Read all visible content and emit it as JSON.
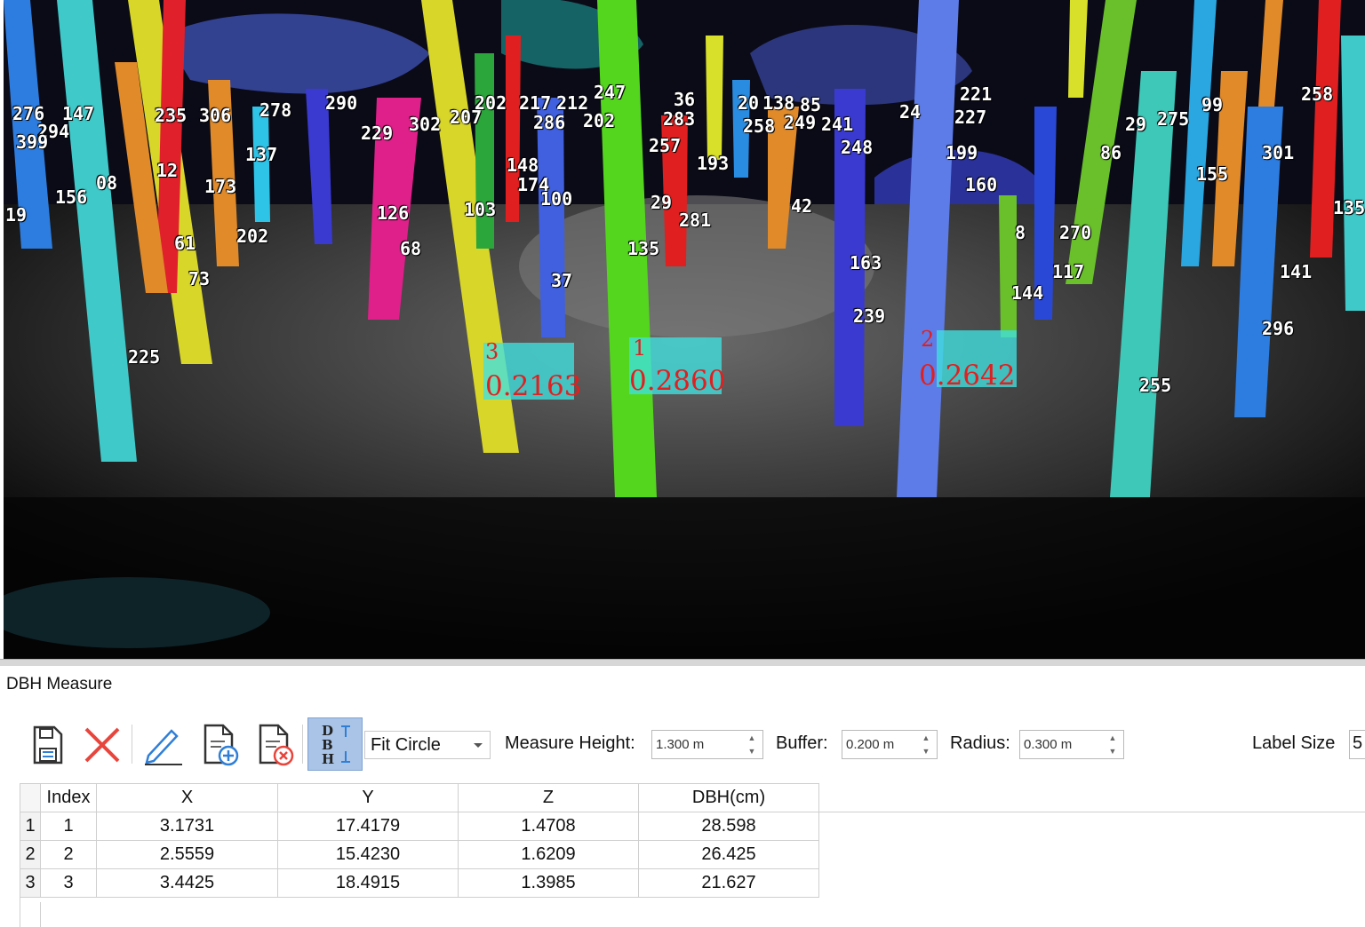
{
  "viewport": {
    "tree_labels": [
      {
        "text": "276"
      },
      {
        "text": "147"
      },
      {
        "text": "294"
      },
      {
        "text": "399"
      },
      {
        "text": "156"
      },
      {
        "text": "08"
      },
      {
        "text": "19"
      },
      {
        "text": "235"
      },
      {
        "text": "306"
      },
      {
        "text": "278"
      },
      {
        "text": "290"
      },
      {
        "text": "229"
      },
      {
        "text": "302"
      },
      {
        "text": "207"
      },
      {
        "text": "202"
      },
      {
        "text": "217"
      },
      {
        "text": "212"
      },
      {
        "text": "247"
      },
      {
        "text": "286"
      },
      {
        "text": "202"
      },
      {
        "text": "36"
      },
      {
        "text": "283"
      },
      {
        "text": "20"
      },
      {
        "text": "138"
      },
      {
        "text": "85"
      },
      {
        "text": "258"
      },
      {
        "text": "249"
      },
      {
        "text": "241"
      },
      {
        "text": "24"
      },
      {
        "text": "221"
      },
      {
        "text": "227"
      },
      {
        "text": "29"
      },
      {
        "text": "275"
      },
      {
        "text": "99"
      },
      {
        "text": "258"
      },
      {
        "text": "12"
      },
      {
        "text": "173"
      },
      {
        "text": "137"
      },
      {
        "text": "148"
      },
      {
        "text": "174"
      },
      {
        "text": "100"
      },
      {
        "text": "257"
      },
      {
        "text": "193"
      },
      {
        "text": "160"
      },
      {
        "text": "248"
      },
      {
        "text": "199"
      },
      {
        "text": "86"
      },
      {
        "text": "155"
      },
      {
        "text": "301"
      },
      {
        "text": "126"
      },
      {
        "text": "103"
      },
      {
        "text": "29"
      },
      {
        "text": "281"
      },
      {
        "text": "42"
      },
      {
        "text": "8"
      },
      {
        "text": "270"
      },
      {
        "text": "135"
      },
      {
        "text": "61"
      },
      {
        "text": "202"
      },
      {
        "text": "68"
      },
      {
        "text": "135"
      },
      {
        "text": "163"
      },
      {
        "text": "117"
      },
      {
        "text": "141"
      },
      {
        "text": "73"
      },
      {
        "text": "37"
      },
      {
        "text": "144"
      },
      {
        "text": "239"
      },
      {
        "text": "296"
      },
      {
        "text": "225"
      },
      {
        "text": "255"
      }
    ],
    "measurements": [
      {
        "index": "3",
        "value": "0.2163"
      },
      {
        "index": "1",
        "value": "0.2860"
      },
      {
        "index": "2",
        "value": "0.2642"
      }
    ]
  },
  "panel": {
    "title": "DBH Measure",
    "toolbar": {
      "icons": [
        "save-icon",
        "delete-icon",
        "edit-icon",
        "add-file-icon",
        "remove-file-icon",
        "dbh-icon"
      ],
      "method_select": "Fit Circle",
      "measure_height_label": "Measure Height:",
      "measure_height_value": "1.300 m",
      "buffer_label": "Buffer:",
      "buffer_value": "0.200 m",
      "radius_label": "Radius:",
      "radius_value": "0.300 m",
      "label_size_label": "Label Size",
      "label_size_value": "5"
    },
    "table": {
      "columns": [
        "Index",
        "X",
        "Y",
        "Z",
        "DBH(cm)"
      ],
      "rows": [
        {
          "row": "1",
          "cells": [
            "1",
            "3.1731",
            "17.4179",
            "1.4708",
            "28.598"
          ]
        },
        {
          "row": "2",
          "cells": [
            "2",
            "2.5559",
            "15.4230",
            "1.6209",
            "26.425"
          ]
        },
        {
          "row": "3",
          "cells": [
            "3",
            "3.4425",
            "18.4915",
            "1.3985",
            "21.627"
          ]
        }
      ]
    }
  },
  "colors": {
    "accent_active": "#a9c4e6",
    "measure_box": "#40e0e0",
    "measure_text": "#e02020",
    "delete_red": "#e8453c",
    "icon_blue": "#2f7fd8"
  }
}
